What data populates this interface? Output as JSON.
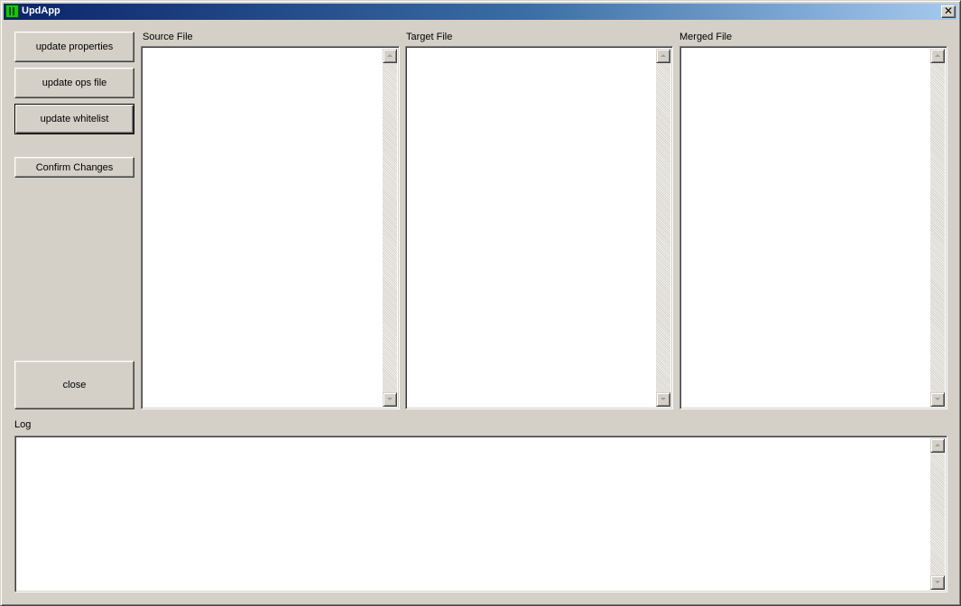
{
  "window": {
    "title": "UpdApp",
    "close_glyph": "✕"
  },
  "buttons": {
    "update_properties": "update properties",
    "update_ops_file": "update ops file",
    "update_whitelist": "update whitelist",
    "confirm_changes": "Confirm Changes",
    "close": "close"
  },
  "panels": {
    "source_label": "Source File",
    "target_label": "Target File",
    "merged_label": "Merged File",
    "log_label": "Log",
    "source_content": "",
    "target_content": "",
    "merged_content": "",
    "log_content": ""
  },
  "icons": {
    "app": "app-icon",
    "close": "close-icon",
    "scroll_up": "scroll-up-arrow-icon",
    "scroll_down": "scroll-down-arrow-icon"
  }
}
